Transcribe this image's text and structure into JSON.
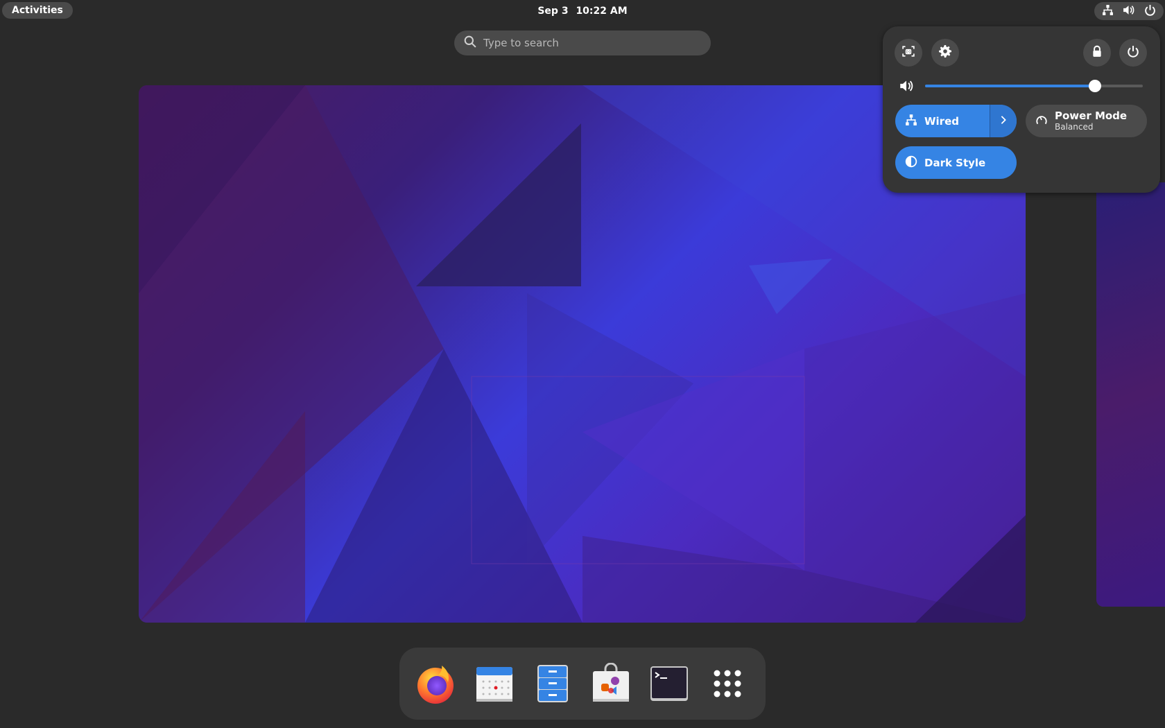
{
  "topbar": {
    "activities_label": "Activities",
    "date": "Sep 3",
    "time": "10:22 AM",
    "status_icons": [
      "network-wired-icon",
      "volume-icon",
      "power-icon"
    ]
  },
  "search": {
    "placeholder": "Type to search"
  },
  "quick_settings": {
    "buttons": [
      "screenshot-icon",
      "settings-icon",
      "lock-icon",
      "power-icon"
    ],
    "volume_level": 0.78,
    "wired": {
      "label": "Wired",
      "active": true
    },
    "power_mode": {
      "title": "Power Mode",
      "subtitle": "Balanced",
      "active": false
    },
    "dark_style": {
      "label": "Dark Style",
      "active": true
    },
    "accent_color": "#3584e4"
  },
  "dash": {
    "apps": [
      "firefox-icon",
      "calendar-icon",
      "files-icon",
      "software-icon",
      "terminal-icon",
      "show-apps-icon"
    ]
  }
}
